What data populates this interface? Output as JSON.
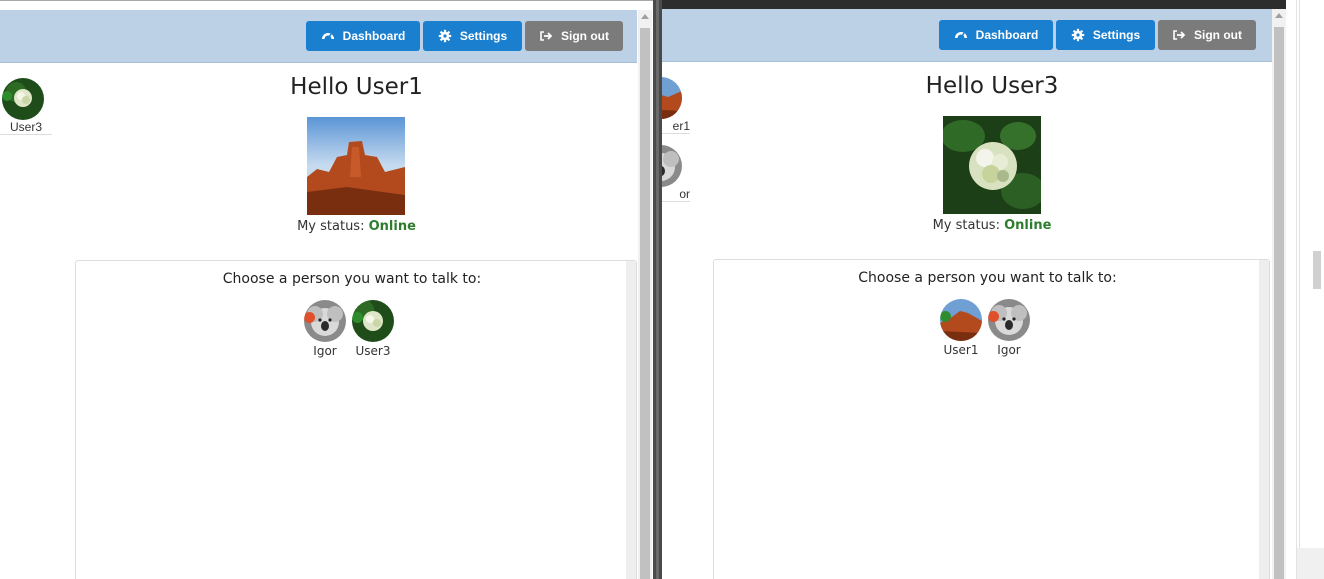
{
  "navbar": {
    "dashboard_label": "Dashboard",
    "settings_label": "Settings",
    "signout_label": "Sign out",
    "icons": [
      "dashboard-icon",
      "gear-icon",
      "sign-out-icon"
    ]
  },
  "left_window": {
    "greeting": "Hello User1",
    "status_label": "My status:",
    "status_value": "Online",
    "panel_title": "Choose a person you want to talk to:",
    "sidebar_users": [
      {
        "name": "User3"
      }
    ],
    "people": [
      {
        "name": "Igor",
        "status": "away"
      },
      {
        "name": "User3",
        "status": "online"
      }
    ]
  },
  "right_window": {
    "greeting": "Hello User3",
    "status_label": "My status:",
    "status_value": "Online",
    "panel_title": "Choose a person you want to talk to:",
    "sidebar_users": [
      {
        "name": "er1"
      },
      {
        "name": "or"
      }
    ],
    "people": [
      {
        "name": "User1",
        "status": "online"
      },
      {
        "name": "Igor",
        "status": "away"
      }
    ]
  },
  "colors": {
    "navbar_bg": "#bcd0e6",
    "primary_button": "#1b7fcf",
    "default_button": "#7b7b7b",
    "online_text": "#2e7d2e",
    "online_dot": "#2e8b2e",
    "away_dot": "#e0502a"
  }
}
